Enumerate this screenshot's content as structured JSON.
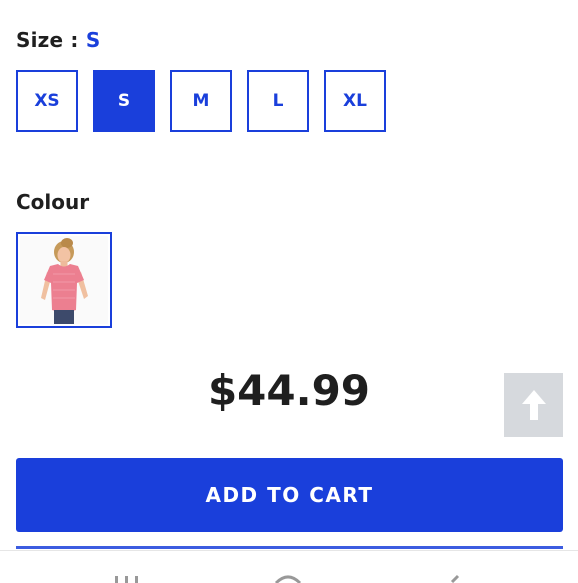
{
  "size_section": {
    "label": "Size :",
    "selected": "S",
    "options": [
      "XS",
      "S",
      "M",
      "L",
      "XL"
    ]
  },
  "colour_section": {
    "label": "Colour",
    "swatch_icon": "pink-tshirt-thumbnail"
  },
  "price": "$44.99",
  "scroll_top_icon": "arrow-up-icon",
  "cart": {
    "label": "ADD TO CART"
  },
  "bottom_nav": {
    "icons": [
      "menu-icon",
      "home-icon",
      "back-icon"
    ]
  },
  "colors": {
    "accent": "#1a3fdb",
    "scroll_bg": "#d6d9dd"
  }
}
